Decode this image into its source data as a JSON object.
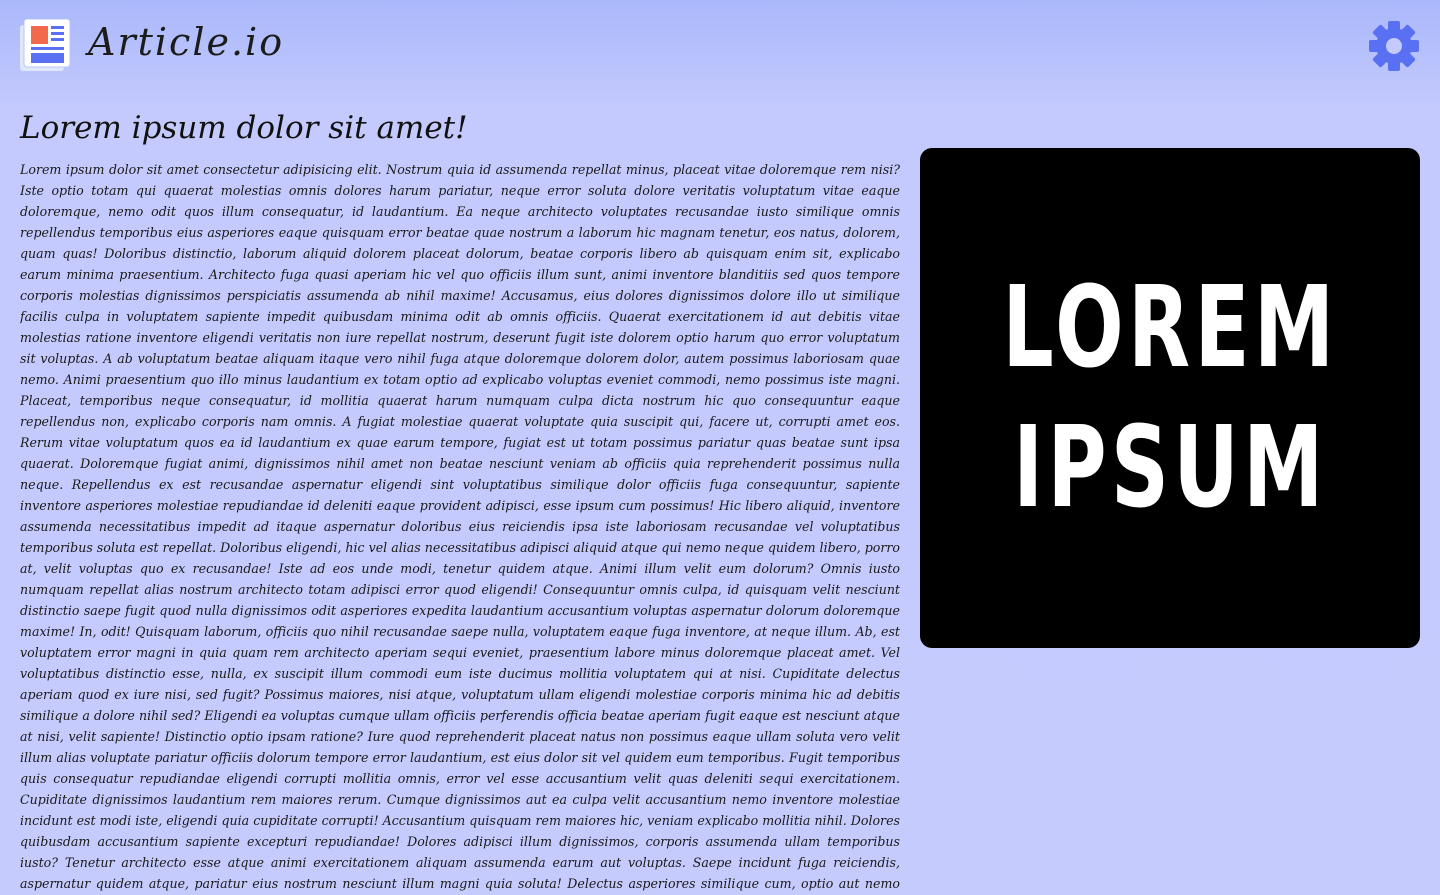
{
  "header": {
    "brand": "Article.io",
    "logo_icon": "newspaper-icon",
    "settings_icon": "gear-icon",
    "accent_color": "#5a70f2"
  },
  "article": {
    "title": "Lorem ipsum dolor sit amet!",
    "body": "Lorem ipsum dolor sit amet consectetur adipisicing elit. Nostrum quia id assumenda repellat minus, placeat vitae doloremque rem nisi? Iste optio totam qui quaerat molestias omnis dolores harum pariatur, neque error soluta dolore veritatis voluptatum vitae eaque doloremque, nemo odit quos illum consequatur, id laudantium. Ea neque architecto voluptates recusandae iusto similique omnis repellendus temporibus eius asperiores eaque quisquam error beatae quae nostrum a laborum hic magnam tenetur, eos natus, dolorem, quam quas! Doloribus distinctio, laborum aliquid dolorem placeat dolorum, beatae corporis libero ab quisquam enim sit, explicabo earum minima praesentium. Architecto fuga quasi aperiam hic vel quo officiis illum sunt, animi inventore blanditiis sed quos tempore corporis molestias dignissimos perspiciatis assumenda ab nihil maxime! Accusamus, eius dolores dignissimos dolore illo ut similique facilis culpa in voluptatem sapiente impedit quibusdam minima odit ab omnis officiis. Quaerat exercitationem id aut debitis vitae molestias ratione inventore eligendi veritatis non iure repellat nostrum, deserunt fugit iste dolorem optio harum quo error voluptatum sit voluptas. A ab voluptatum beatae aliquam itaque vero nihil fuga atque doloremque dolorem dolor, autem possimus laboriosam quae nemo. Animi praesentium quo illo minus laudantium ex totam optio ad explicabo voluptas eveniet commodi, nemo possimus iste magni. Placeat, temporibus neque consequatur, id mollitia quaerat harum numquam culpa dicta nostrum hic quo consequuntur eaque repellendus non, explicabo corporis nam omnis. A fugiat molestiae quaerat voluptate quia suscipit qui, facere ut, corrupti amet eos. Rerum vitae voluptatum quos ea id laudantium ex quae earum tempore, fugiat est ut totam possimus pariatur quas beatae sunt ipsa quaerat. Doloremque fugiat animi, dignissimos nihil amet non beatae nesciunt veniam ab officiis quia reprehenderit possimus nulla neque. Repellendus ex est recusandae aspernatur eligendi sint voluptatibus similique dolor officiis fuga consequuntur, sapiente inventore asperiores molestiae repudiandae id deleniti eaque provident adipisci, esse ipsum cum possimus! Hic libero aliquid, inventore assumenda necessitatibus impedit ad itaque aspernatur doloribus eius reiciendis ipsa iste laboriosam recusandae vel voluptatibus temporibus soluta est repellat. Doloribus eligendi, hic vel alias necessitatibus adipisci aliquid atque qui nemo neque quidem libero, porro at, velit voluptas quo ex recusandae! Iste ad eos unde modi, tenetur quidem atque. Animi illum velit eum dolorum? Omnis iusto numquam repellat alias nostrum architecto totam adipisci error quod eligendi! Consequuntur omnis culpa, id quisquam velit nesciunt distinctio saepe fugit quod nulla dignissimos odit asperiores expedita laudantium accusantium voluptas aspernatur dolorum doloremque maxime! In, odit! Quisquam laborum, officiis quo nihil recusandae saepe nulla, voluptatem eaque fuga inventore, at neque illum. Ab, est voluptatem error magni in quia quam rem architecto aperiam sequi eveniet, praesentium labore minus doloremque placeat amet. Vel voluptatibus distinctio esse, nulla, ex suscipit illum commodi eum iste ducimus mollitia voluptatem qui at nisi. Cupiditate delectus aperiam quod ex iure nisi, sed fugit? Possimus maiores, nisi atque, voluptatum ullam eligendi molestiae corporis minima hic ad debitis similique a dolore nihil sed? Eligendi ea voluptas cumque ullam officiis perferendis officia beatae aperiam fugit eaque est nesciunt atque at nisi, velit sapiente! Distinctio optio ipsam ratione? Iure quod reprehenderit placeat natus non possimus eaque ullam soluta vero velit illum alias voluptate pariatur officiis dolorum tempore error laudantium, est eius dolor sit vel quidem eum temporibus. Fugit temporibus quis consequatur repudiandae eligendi corrupti mollitia omnis, error vel esse accusantium velit quas deleniti sequi exercitationem. Cupiditate dignissimos laudantium rem maiores rerum. Cumque dignissimos aut ea culpa velit accusantium nemo inventore molestiae incidunt est modi iste, eligendi quia cupiditate corrupti! Accusantium quisquam rem maiores hic, veniam explicabo mollitia nihil. Dolores quibusdam accusantium sapiente excepturi repudiandae! Dolores adipisci illum dignissimos, corporis assumenda ullam temporibus iusto? Tenetur architecto esse atque animi exercitationem aliquam assumenda earum aut voluptas. Saepe incidunt fuga reiciendis, aspernatur quidem atque, pariatur eius nostrum nesciunt illum magni quia soluta! Delectus asperiores similique cum, optio aut nemo numquam, quo eius at obcaecati modi sint! Ex eveniet soluta aut sequi modi voluptas. Veritatis quam possimus vel omnis placeat, ab laboriosam, iusto cumque, fugiat eum laudantium distinctio! Pariatur dolor quo hic quidem ipsum consequatur et iste, id repellat, enim aliquid accusantium dicta blanditiis unde consectetur quasi nihil dignissimos nam sint, beatae veritatis est ducimus quia similique? Ducimus ab aspernatur incidunt alias fuga eligendi impedit eius assumenda minima optio fugit totam corporis, ipsam cupiditate tempore quaerat rerum? Blanditiis, ullam porro recusandae esse ex adipisci beatae eveniet quidem modi quam assumenda nulla. Necessitatibus in quasi officia recusandae libero pariatur atque at labore repellat nisi illum repudiandae accusantium odio animi molestias, quo velit. Velit quis eveniet magnam, eos debitis"
  },
  "hero_image": {
    "line1": "LOREM",
    "line2": "IPSUM",
    "background": "#000000",
    "text_color": "#ffffff"
  }
}
